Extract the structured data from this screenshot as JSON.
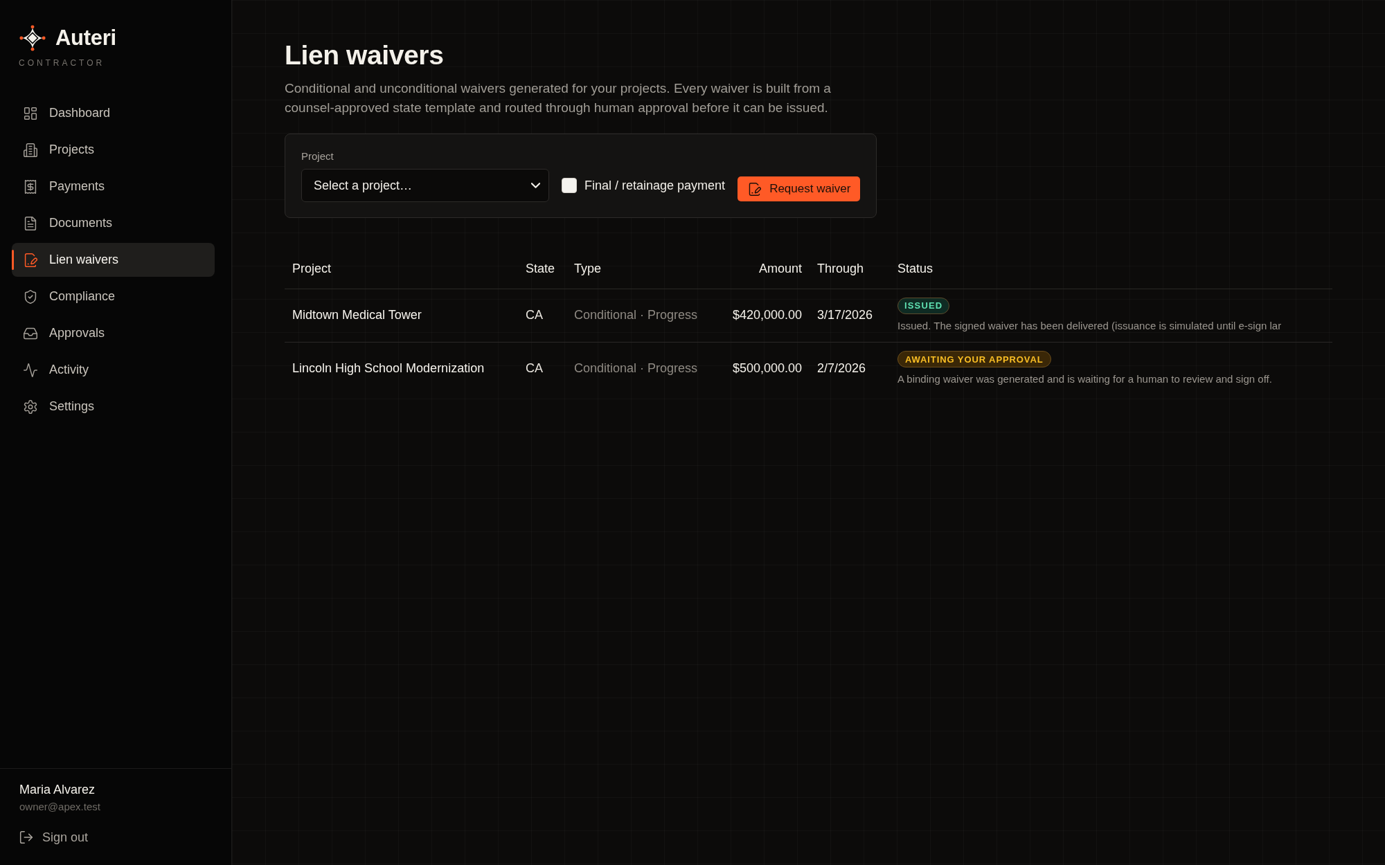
{
  "sidebar": {
    "brand": {
      "name": "Auteri",
      "subtitle": "CONTRACTOR"
    },
    "nav": [
      {
        "label": "Dashboard",
        "selected": false
      },
      {
        "label": "Projects",
        "selected": false
      },
      {
        "label": "Payments",
        "selected": false
      },
      {
        "label": "Documents",
        "selected": false
      },
      {
        "label": "Lien waivers",
        "selected": true
      },
      {
        "label": "Compliance",
        "selected": false
      },
      {
        "label": "Approvals",
        "selected": false
      },
      {
        "label": "Activity",
        "selected": false
      },
      {
        "label": "Settings",
        "selected": false
      }
    ],
    "user": {
      "name": "Maria Alvarez",
      "email": "owner@apex.test"
    },
    "sign_out": "Sign out"
  },
  "page": {
    "title": "Lien waivers",
    "description": "Conditional and unconditional waivers generated for your projects. Every waiver is built from a counsel-approved state template and routed through human approval before it can be issued."
  },
  "request_form": {
    "project_label": "Project",
    "project_select": {
      "value": "Select a project…"
    },
    "final_payment": {
      "label": "Final / retainage payment",
      "checked": false
    },
    "submit_button": "Request waiver"
  },
  "table": {
    "columns": [
      "Project",
      "State",
      "Type",
      "Amount",
      "Through",
      "Status"
    ],
    "rows": [
      {
        "project": "Midtown Medical Tower",
        "state": "CA",
        "type": "Conditional · Progress",
        "amount": "$420,000.00",
        "through": "3/17/2026",
        "status": {
          "kind": "issued",
          "badge": "ISSUED",
          "description": "Issued. The signed waiver has been delivered (issuance is simulated until e-sign lar"
        }
      },
      {
        "project": "Lincoln High School Modernization",
        "state": "CA",
        "type": "Conditional · Progress",
        "amount": "$500,000.00",
        "through": "2/7/2026",
        "status": {
          "kind": "awaiting",
          "badge": "AWAITING YOUR APPROVAL",
          "description": "A binding waiver was generated and is waiting for a human to review and sign off."
        }
      }
    ]
  }
}
